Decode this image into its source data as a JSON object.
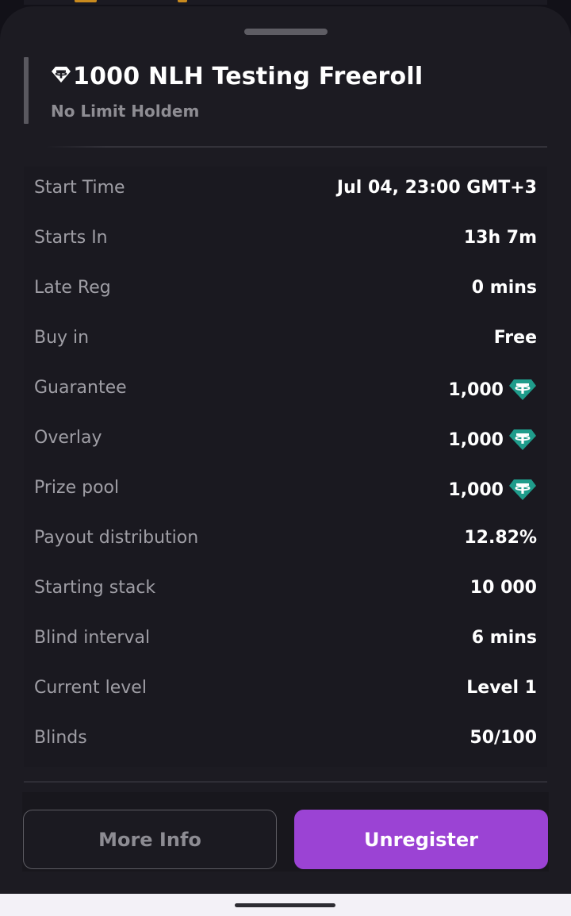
{
  "tournament": {
    "title": "1000 NLH Testing Freeroll",
    "subtitle": "No Limit Holdem"
  },
  "details": [
    {
      "label": "Start Time",
      "value": "Jul 04, 23:00 GMT+3",
      "icon": ""
    },
    {
      "label": "Starts In",
      "value": "13h 7m",
      "icon": ""
    },
    {
      "label": "Late Reg",
      "value": "0 mins",
      "icon": ""
    },
    {
      "label": "Buy in",
      "value": "Free",
      "icon": ""
    },
    {
      "label": "Guarantee",
      "value": "1,000",
      "icon": "usdt-icon"
    },
    {
      "label": "Overlay",
      "value": "1,000",
      "icon": "usdt-icon"
    },
    {
      "label": "Prize pool",
      "value": "1,000",
      "icon": "usdt-icon"
    },
    {
      "label": "Payout distribution",
      "value": "12.82%",
      "icon": ""
    },
    {
      "label": "Starting stack",
      "value": "10 000",
      "icon": ""
    },
    {
      "label": "Blind interval",
      "value": "6 mins",
      "icon": ""
    },
    {
      "label": "Current level",
      "value": "Level 1",
      "icon": ""
    },
    {
      "label": "Blinds",
      "value": "50/100",
      "icon": ""
    }
  ],
  "actions": {
    "more_info_label": "More Info",
    "unregister_label": "Unregister"
  },
  "colors": {
    "accent_purple": "#9b43d4",
    "usdt_teal": "#1f9c8b",
    "sheet_background": "#1c1b22"
  }
}
